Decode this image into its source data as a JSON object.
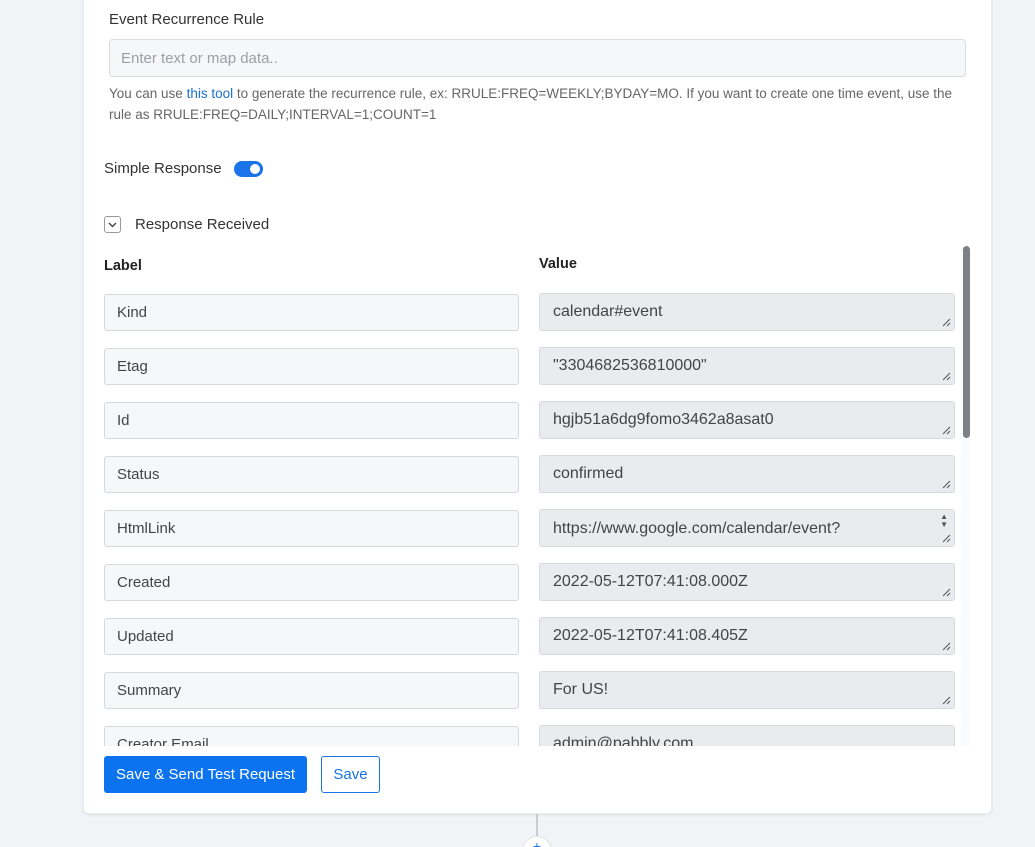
{
  "recurrence": {
    "label": "Event Recurrence Rule",
    "placeholder": "Enter text or map data..",
    "help_prefix": "You can use ",
    "help_link": "this tool",
    "help_suffix": " to generate the recurrence rule, ex: RRULE:FREQ=WEEKLY;BYDAY=MO. If you want to create one time event, use the rule as RRULE:FREQ=DAILY;INTERVAL=1;COUNT=1"
  },
  "simple_response": {
    "label": "Simple Response",
    "enabled": true
  },
  "response": {
    "label": "Response Received",
    "expanded": true,
    "label_header": "Label",
    "value_header": "Value",
    "rows": [
      {
        "label": "Kind",
        "value": "calendar#event"
      },
      {
        "label": "Etag",
        "value": "\"3304682536810000\""
      },
      {
        "label": "Id",
        "value": "hgjb51a6dg9fomo3462a8asat0"
      },
      {
        "label": "Status",
        "value": "confirmed"
      },
      {
        "label": "HtmlLink",
        "value": "https://www.google.com/calendar/event?"
      },
      {
        "label": "Created",
        "value": "2022-05-12T07:41:08.000Z"
      },
      {
        "label": "Updated",
        "value": "2022-05-12T07:41:08.405Z"
      },
      {
        "label": "Summary",
        "value": "For US!"
      },
      {
        "label": "Creator Email",
        "value": "admin@pabbly.com"
      }
    ]
  },
  "actions": {
    "save_send_label": "Save & Send Test Request",
    "save_label": "Save"
  },
  "colors": {
    "accent": "#0b73f0",
    "link": "#1a6fd1"
  },
  "icons": {
    "toggle": "toggle-on",
    "expand": "chevron-down-icon",
    "resize": "resize-grip-icon",
    "add": "plus-icon"
  }
}
